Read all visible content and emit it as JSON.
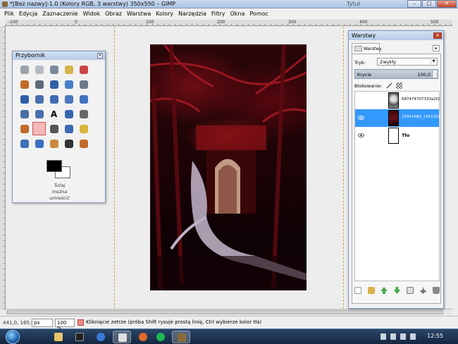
{
  "window": {
    "title": "*[Bez nazwy]-1.0 (Kolory RGB, 3 warstwy) 350x550 – GIMP",
    "other_tab_text": "Tytuł"
  },
  "menu": [
    "Plik",
    "Edycja",
    "Zaznaczenie",
    "Widok",
    "Obraz",
    "Warstwa",
    "Kolory",
    "Narzędzia",
    "Filtry",
    "Okna",
    "Pomoc"
  ],
  "ruler": {
    "ticks": [
      "-100",
      "0",
      "100",
      "200",
      "300",
      "400",
      "500"
    ]
  },
  "toolbox": {
    "title": "Przybornik",
    "dropzone_text": [
      "Tutaj",
      "można",
      "umieścić"
    ],
    "tools": [
      "rect-select-icon",
      "ellipse-select-icon",
      "free-select-icon",
      "fuzzy-select-icon",
      "scissors-icon",
      "foreground-select-icon",
      "paths-icon",
      "color-picker-icon",
      "zoom-icon",
      "measure-icon",
      "move-icon",
      "align-icon",
      "crop-icon",
      "rotate-icon",
      "scale-icon",
      "perspective-icon",
      "flip-icon",
      "text-icon",
      "bucket-fill-icon",
      "blend-icon",
      "pencil-icon",
      "eraser-icon",
      "airbrush-icon",
      "ink-icon",
      "heal-icon",
      "clone-icon",
      "blur-icon",
      "smudge-icon",
      "dodge-burn-icon",
      "paintbrush-icon"
    ],
    "selected_tool": "eraser-icon",
    "foreground_color": "#000000",
    "background_color": "#ffffff"
  },
  "layers": {
    "title": "Warstwy",
    "tab_label": "Warstwy",
    "mode_label": "Tryb:",
    "mode_value": "Zwykły",
    "opacity_label": "Krycie",
    "opacity_value": "100,0",
    "lock_label": "Blokowanie:",
    "items": [
      {
        "name": "687474707333a2f2f73",
        "visible": false,
        "selected": false
      },
      {
        "name": "15941684_14512616",
        "visible": true,
        "selected": true
      },
      {
        "name": "Tło",
        "visible": true,
        "selected": false
      }
    ]
  },
  "status": {
    "coords": "441,0, 165,0",
    "unit": "px",
    "zoom": "100 %",
    "message": "Kliknięcie zetrze (próba Shift rysuje prostą linię, Ctrl wybierze kolor tła)"
  },
  "taskbar": {
    "clock": "12:55",
    "apps": [
      "explorer-icon",
      "terminal-icon",
      "firefox-icon",
      "spotify-icon",
      "gimp-icon"
    ]
  },
  "colors": {
    "accent_selection": "#3399ff",
    "image_dominant": "#2a0608",
    "image_highlight": "#b41e1e"
  }
}
